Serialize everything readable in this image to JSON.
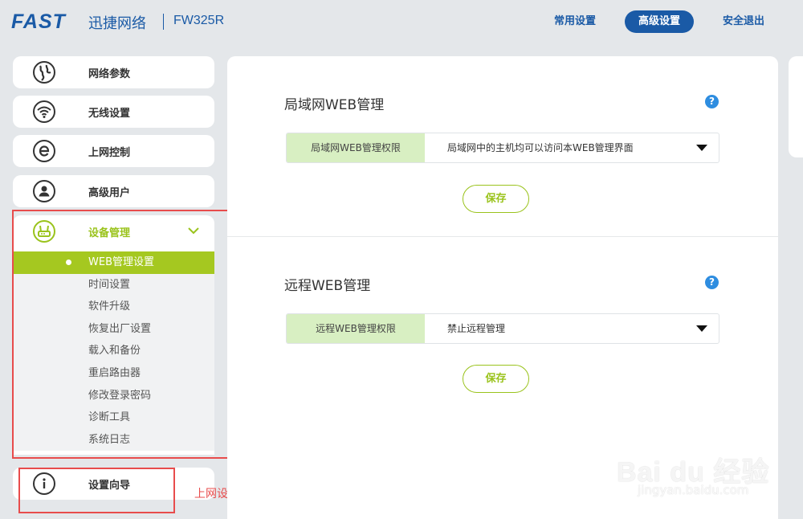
{
  "header": {
    "brand": "FAST",
    "brand_cn": "迅捷网络",
    "model": "FW325R",
    "nav": {
      "common": "常用设置",
      "advanced": "高级设置",
      "logout": "安全退出"
    }
  },
  "sidebar": {
    "items": [
      {
        "label": "网络参数",
        "icon": "globe-icon"
      },
      {
        "label": "无线设置",
        "icon": "wifi-icon"
      },
      {
        "label": "上网控制",
        "icon": "browser-e-icon"
      },
      {
        "label": "高级用户",
        "icon": "user-icon"
      }
    ],
    "device_mgmt": {
      "label": "设备管理",
      "icon": "router-icon",
      "sub_items": [
        "WEB管理设置",
        "时间设置",
        "软件升级",
        "恢复出厂设置",
        "载入和备份",
        "重启路由器",
        "修改登录密码",
        "诊断工具",
        "系统日志"
      ],
      "active_index": 0
    },
    "wizard": {
      "label": "设置向导",
      "icon": "info-icon"
    }
  },
  "annotation": "上网设备",
  "main": {
    "lan": {
      "title": "局域网WEB管理",
      "help": "?",
      "field_label": "局域网WEB管理权限",
      "field_value": "局域网中的主机均可以访问本WEB管理界面",
      "save": "保存"
    },
    "remote": {
      "title": "远程WEB管理",
      "help": "?",
      "field_label": "远程WEB管理权限",
      "field_value": "禁止远程管理",
      "save": "保存"
    }
  },
  "watermark": {
    "logo": "Bai du 经验",
    "url": "jingyan.baidu.com"
  },
  "colors": {
    "brand_blue": "#1a5aa6",
    "accent_green": "#a5c820",
    "annotation_red": "#e84c4c",
    "help_blue": "#2e8de0"
  }
}
